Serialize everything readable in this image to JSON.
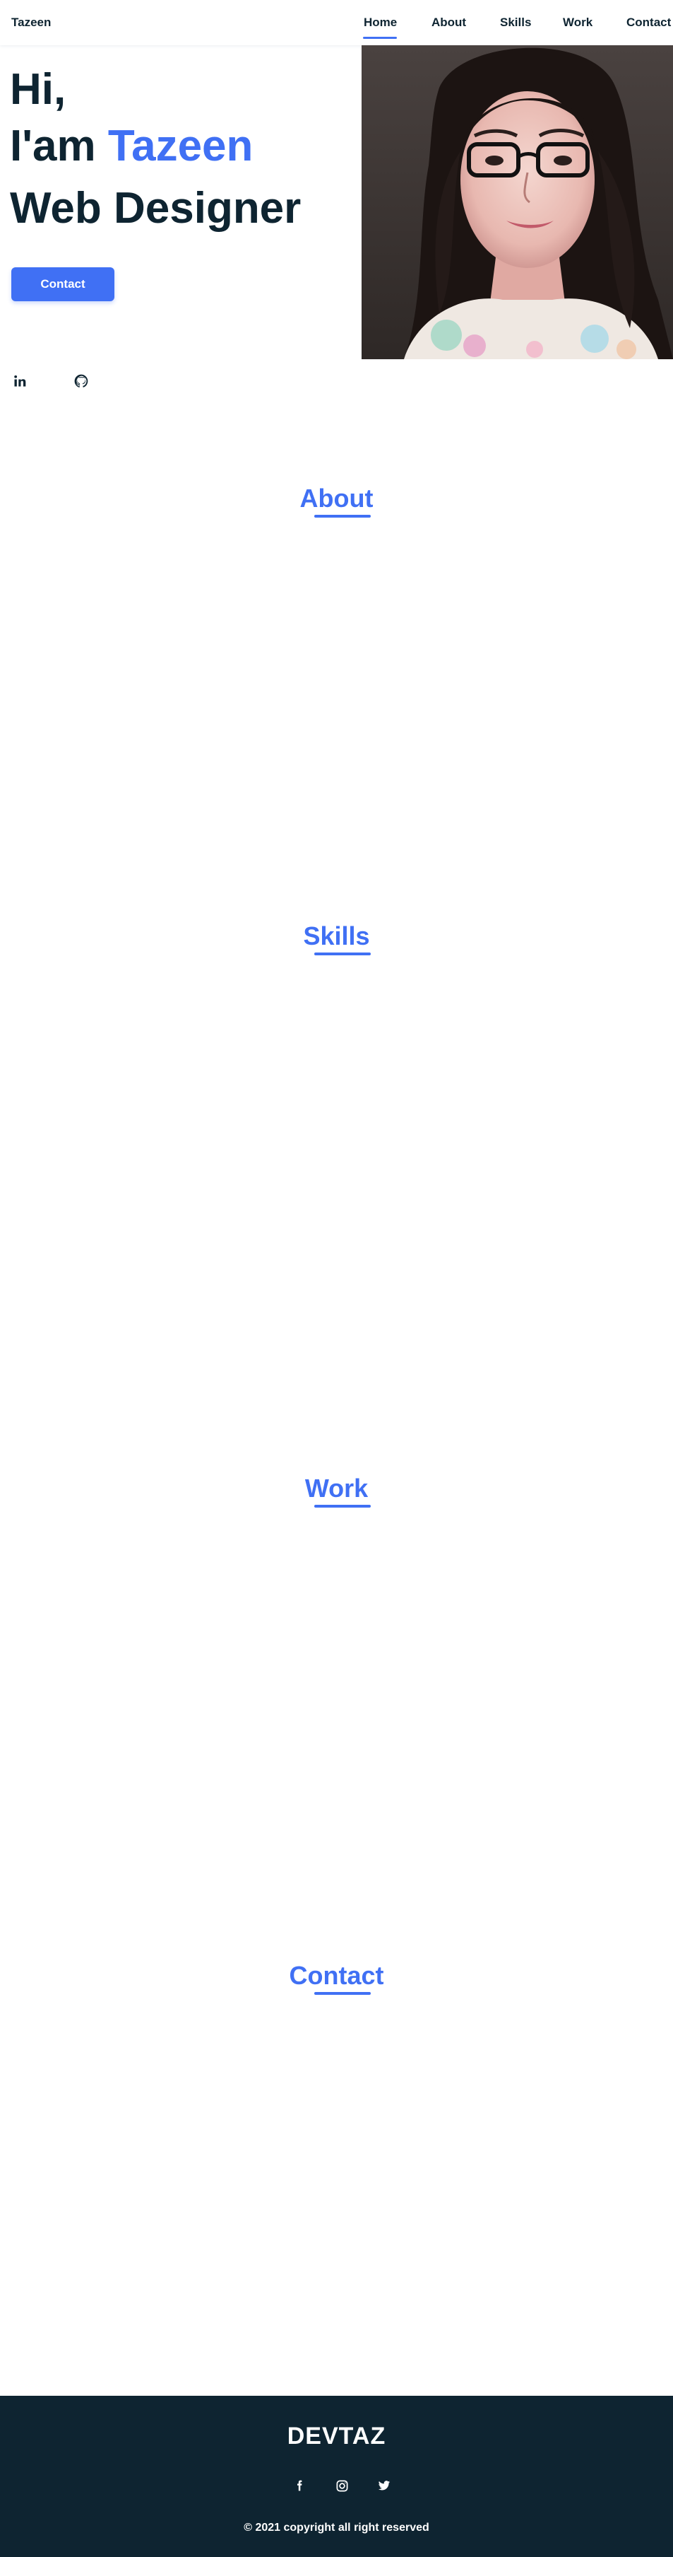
{
  "header": {
    "logo": "Tazeen",
    "nav": [
      {
        "label": "Home",
        "active": true
      },
      {
        "label": "About"
      },
      {
        "label": "Skills"
      },
      {
        "label": "Work"
      },
      {
        "label": "Contact"
      }
    ]
  },
  "hero": {
    "line1": "Hi,",
    "line2_prefix": "I'am",
    "name": "Tazeen",
    "line3": "Web Designer",
    "button_label": "Contact",
    "social_icons": [
      "linkedin-icon",
      "github-icon"
    ]
  },
  "sections": {
    "about": "About",
    "skills": "Skills",
    "work": "Work",
    "contact": "Contact"
  },
  "footer": {
    "title": "DEVTAZ",
    "icons": [
      "facebook-icon",
      "instagram-icon",
      "twitter-icon"
    ],
    "copyright": "© 2021 copyright all right reserved"
  },
  "colors": {
    "accent": "#4070f4",
    "dark": "#0e2431",
    "white": "#ffffff"
  }
}
